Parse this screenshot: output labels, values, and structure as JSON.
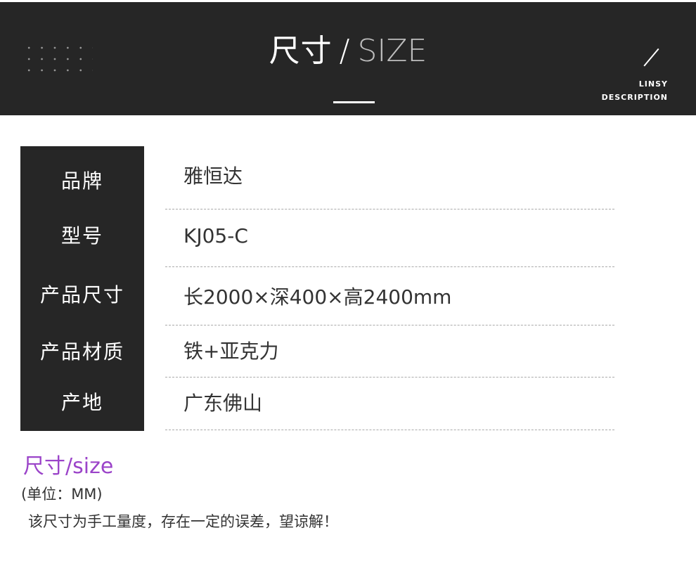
{
  "header": {
    "title_cn": "尺寸",
    "title_sep": "/",
    "title_en": "SIZE",
    "brand_line1": "LINSY",
    "brand_line2": "DESCRIPTION",
    "background_color": "#262626"
  },
  "spec_table": {
    "rows": [
      {
        "label": "品牌",
        "value": "雅恒达"
      },
      {
        "label": "型号",
        "value": "KJ05-C"
      },
      {
        "label": "产品尺寸",
        "value": "长2000×深400×高2400mm"
      },
      {
        "label": "产品材质",
        "value": "铁+亚克力"
      },
      {
        "label": "产地",
        "value": "广东佛山"
      }
    ]
  },
  "size_note": {
    "heading": "尺寸/size",
    "heading_color": "#9b44c9",
    "unit": "(单位：MM)",
    "disclaimer": "该尺寸为手工量度，存在一定的误差，望谅解！"
  }
}
